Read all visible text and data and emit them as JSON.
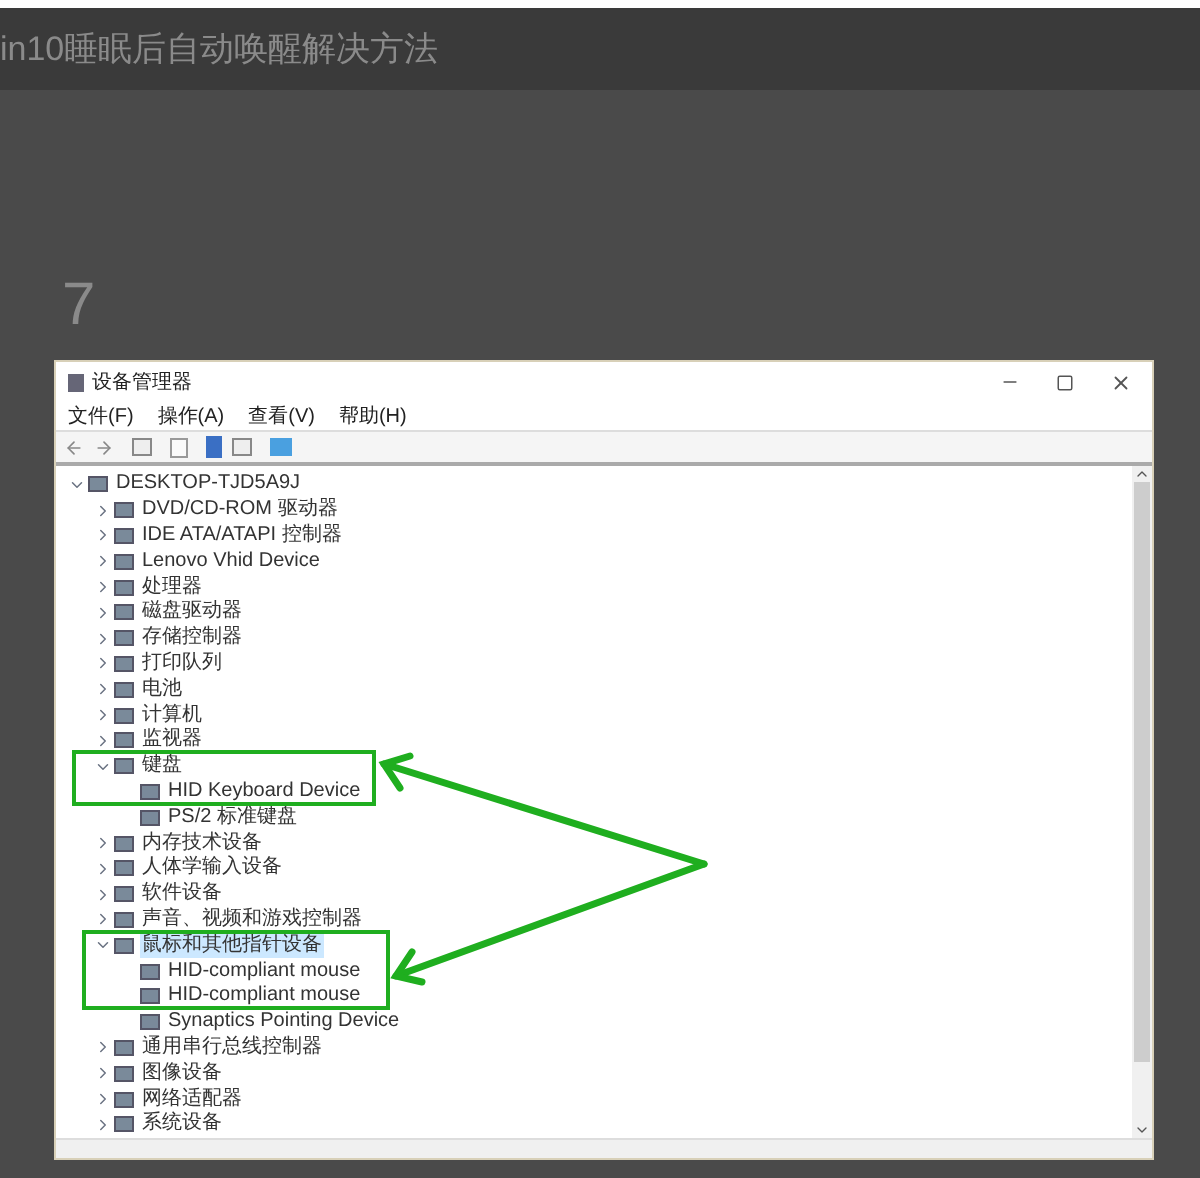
{
  "page": {
    "title": "in10睡眠后自动唤醒解决方法",
    "step": "7"
  },
  "window": {
    "title": "设备管理器"
  },
  "menu": [
    "文件(F)",
    "操作(A)",
    "查看(V)",
    "帮助(H)"
  ],
  "tree": [
    {
      "label": "DESKTOP-TJD5A9J",
      "expanded": true,
      "selected": false,
      "children": [
        {
          "label": "DVD/CD-ROM 驱动器",
          "expanded": false,
          "selected": false
        },
        {
          "label": "IDE ATA/ATAPI 控制器",
          "expanded": false,
          "selected": false
        },
        {
          "label": "Lenovo Vhid Device",
          "expanded": false,
          "selected": false
        },
        {
          "label": "处理器",
          "expanded": false,
          "selected": false
        },
        {
          "label": "磁盘驱动器",
          "expanded": false,
          "selected": false
        },
        {
          "label": "存储控制器",
          "expanded": false,
          "selected": false
        },
        {
          "label": "打印队列",
          "expanded": false,
          "selected": false
        },
        {
          "label": "电池",
          "expanded": false,
          "selected": false
        },
        {
          "label": "计算机",
          "expanded": false,
          "selected": false
        },
        {
          "label": "监视器",
          "expanded": false,
          "selected": false
        },
        {
          "label": "键盘",
          "expanded": true,
          "selected": false,
          "children": [
            {
              "label": "HID Keyboard Device",
              "selected": false
            },
            {
              "label": "PS/2 标准键盘",
              "selected": false
            }
          ]
        },
        {
          "label": "内存技术设备",
          "expanded": false,
          "selected": false
        },
        {
          "label": "人体学输入设备",
          "expanded": false,
          "selected": false
        },
        {
          "label": "软件设备",
          "expanded": false,
          "selected": false
        },
        {
          "label": "声音、视频和游戏控制器",
          "expanded": false,
          "selected": false
        },
        {
          "label": "鼠标和其他指针设备",
          "expanded": true,
          "selected": true,
          "children": [
            {
              "label": "HID-compliant mouse",
              "selected": false
            },
            {
              "label": "HID-compliant mouse",
              "selected": false
            },
            {
              "label": "Synaptics Pointing Device",
              "selected": false
            }
          ]
        },
        {
          "label": "通用串行总线控制器",
          "expanded": false,
          "selected": false
        },
        {
          "label": "图像设备",
          "expanded": false,
          "selected": false
        },
        {
          "label": "网络适配器",
          "expanded": false,
          "selected": false
        },
        {
          "label": "系统设备",
          "expanded": false,
          "selected": false
        }
      ]
    }
  ]
}
